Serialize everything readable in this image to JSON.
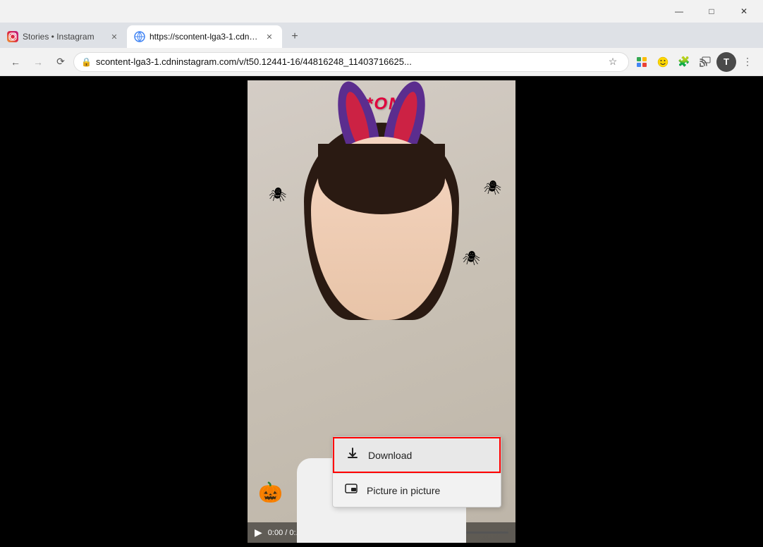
{
  "titleBar": {
    "minimize": "—",
    "maximize": "□",
    "close": "✕"
  },
  "tabs": [
    {
      "id": "tab-instagram",
      "favicon": "instagram",
      "title": "Stories • Instagram",
      "active": false,
      "closeable": true
    },
    {
      "id": "tab-cdn",
      "favicon": "globe",
      "title": "https://scontent-lga3-1.cdninsta...",
      "active": true,
      "closeable": true
    }
  ],
  "newTabLabel": "+",
  "addressBar": {
    "backDisabled": false,
    "forwardDisabled": true,
    "url": "scontent-lga3-1.cdninstagram.com/v/t50.12441-16/44816248_11403716625...",
    "secure": true
  },
  "toolbar": {
    "extensionGrid": "⊞",
    "puzzle": "🧩",
    "menu1": "≡",
    "profile": "T",
    "moreIcon": "⋮"
  },
  "video": {
    "time": "0:00 / 0:...",
    "logoText": "IZ*ONE"
  },
  "contextMenu": {
    "items": [
      {
        "id": "download",
        "icon": "⬇",
        "label": "Download",
        "highlighted": true
      },
      {
        "id": "picture-in-picture",
        "icon": "⊡",
        "label": "Picture in picture",
        "highlighted": false
      }
    ]
  }
}
